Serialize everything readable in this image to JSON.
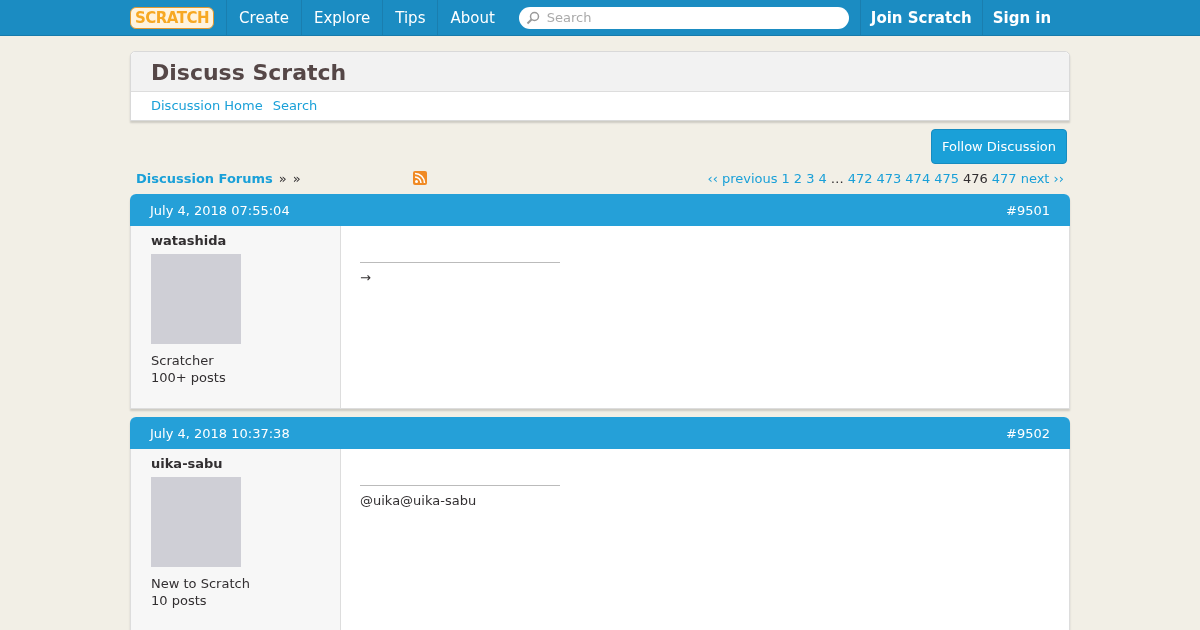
{
  "nav": {
    "logo": "SCRATCH",
    "links": [
      "Create",
      "Explore",
      "Tips",
      "About"
    ],
    "search": {
      "placeholder": "Search"
    },
    "account": [
      "Join Scratch",
      "Sign in"
    ]
  },
  "header": {
    "title": "Discuss Scratch",
    "links": [
      "Discussion Home",
      "Search"
    ]
  },
  "follow_button": "Follow Discussion",
  "breadcrumb": {
    "link": "Discussion Forums",
    "separators": [
      "»",
      "»"
    ]
  },
  "pagination": {
    "previous": "‹‹ previous",
    "pages": [
      {
        "label": "1",
        "selected": false
      },
      {
        "label": "2",
        "selected": false
      },
      {
        "label": "3",
        "selected": false
      },
      {
        "label": "4",
        "selected": false
      },
      {
        "label": "…",
        "kind": "gap"
      },
      {
        "label": "472",
        "selected": false
      },
      {
        "label": "473",
        "selected": false
      },
      {
        "label": "474",
        "selected": false
      },
      {
        "label": "475",
        "selected": false
      },
      {
        "label": "476",
        "selected": true
      },
      {
        "label": "477",
        "selected": false
      }
    ],
    "next": "next ››"
  },
  "posts": [
    {
      "date": "July 4, 2018 07:55:04",
      "number": "#9501",
      "user": "watashida",
      "rank": "Scratcher",
      "posts": "100+ posts",
      "body": "→"
    },
    {
      "date": "July 4, 2018 10:37:38",
      "number": "#9502",
      "user": "uika-sabu",
      "rank": "New to Scratch",
      "posts": "10 posts",
      "body": "@uika@uika-sabu"
    }
  ]
}
